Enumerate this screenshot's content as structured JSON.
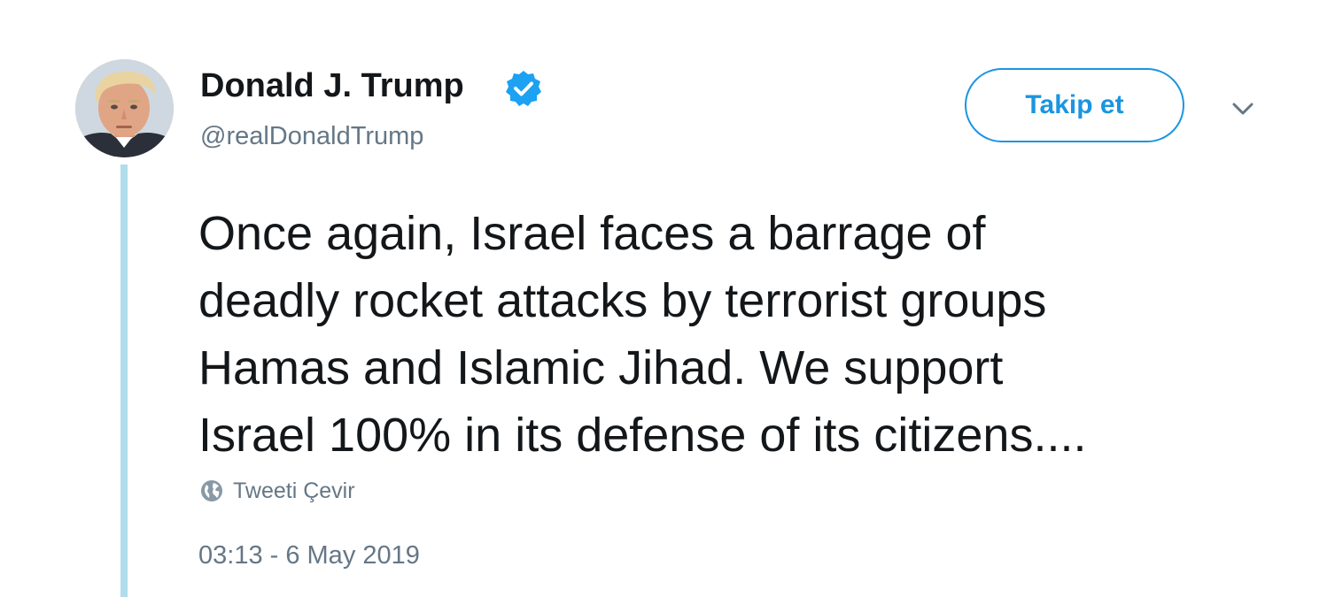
{
  "tweet": {
    "author": {
      "display_name": "Donald J. Trump",
      "handle": "@realDonaldTrump",
      "verified": true
    },
    "follow_label": "Takip et",
    "text_lines": [
      "Once again, Israel faces a barrage of",
      "deadly rocket attacks by terrorist groups",
      "Hamas and Islamic Jihad. We support",
      "Israel 100% in its defense of its citizens...."
    ],
    "translate_label": "Tweeti Çevir",
    "timestamp": "03:13 - 6 May 2019"
  },
  "colors": {
    "brand_blue": "#1b95e0",
    "text_primary": "#14171a",
    "text_secondary": "#657786",
    "thread_line": "#b0dcec"
  },
  "icons": {
    "verified": "verified-badge-icon",
    "more": "chevron-down-icon",
    "translate": "globe-icon"
  }
}
